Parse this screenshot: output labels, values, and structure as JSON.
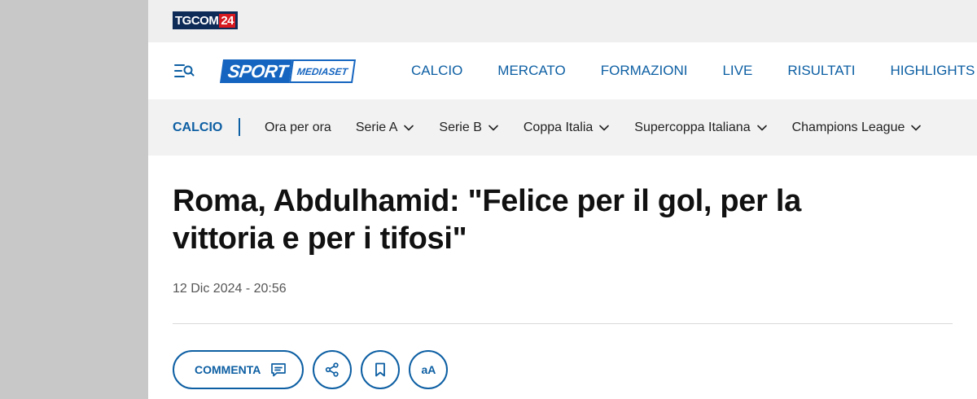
{
  "brand": {
    "tgcom_text": "TGCOM",
    "tgcom_num": "24",
    "sport_text": "SPORT",
    "mediaset_text": "MEDIASET"
  },
  "mainnav": {
    "items": [
      {
        "label": "CALCIO"
      },
      {
        "label": "MERCATO"
      },
      {
        "label": "FORMAZIONI"
      },
      {
        "label": "LIVE"
      },
      {
        "label": "RISULTATI"
      },
      {
        "label": "HIGHLIGHTS"
      }
    ]
  },
  "subnav": {
    "section": "CALCIO",
    "items": [
      {
        "label": "Ora per ora",
        "icon": null
      },
      {
        "label": "Serie A",
        "icon": "chevron-down-icon"
      },
      {
        "label": "Serie B",
        "icon": "chevron-down-icon"
      },
      {
        "label": "Coppa Italia",
        "icon": "chevron-down-icon"
      },
      {
        "label": "Supercoppa Italiana",
        "icon": "chevron-down-icon"
      },
      {
        "label": "Champions League",
        "icon": "chevron-down-icon"
      }
    ]
  },
  "article": {
    "title": "Roma, Abdulhamid: \"Felice per il gol, per la vittoria e per i tifosi\"",
    "date": "12 Dic 2024 - 20:56"
  },
  "actions": {
    "comment_label": "COMMENTA",
    "font_size_label": "aA"
  },
  "colors": {
    "accent": "#0d5fa3",
    "brand_blue": "#1565c0",
    "tgcom_navy": "#0e2a57",
    "tgcom_red": "#d71920"
  }
}
